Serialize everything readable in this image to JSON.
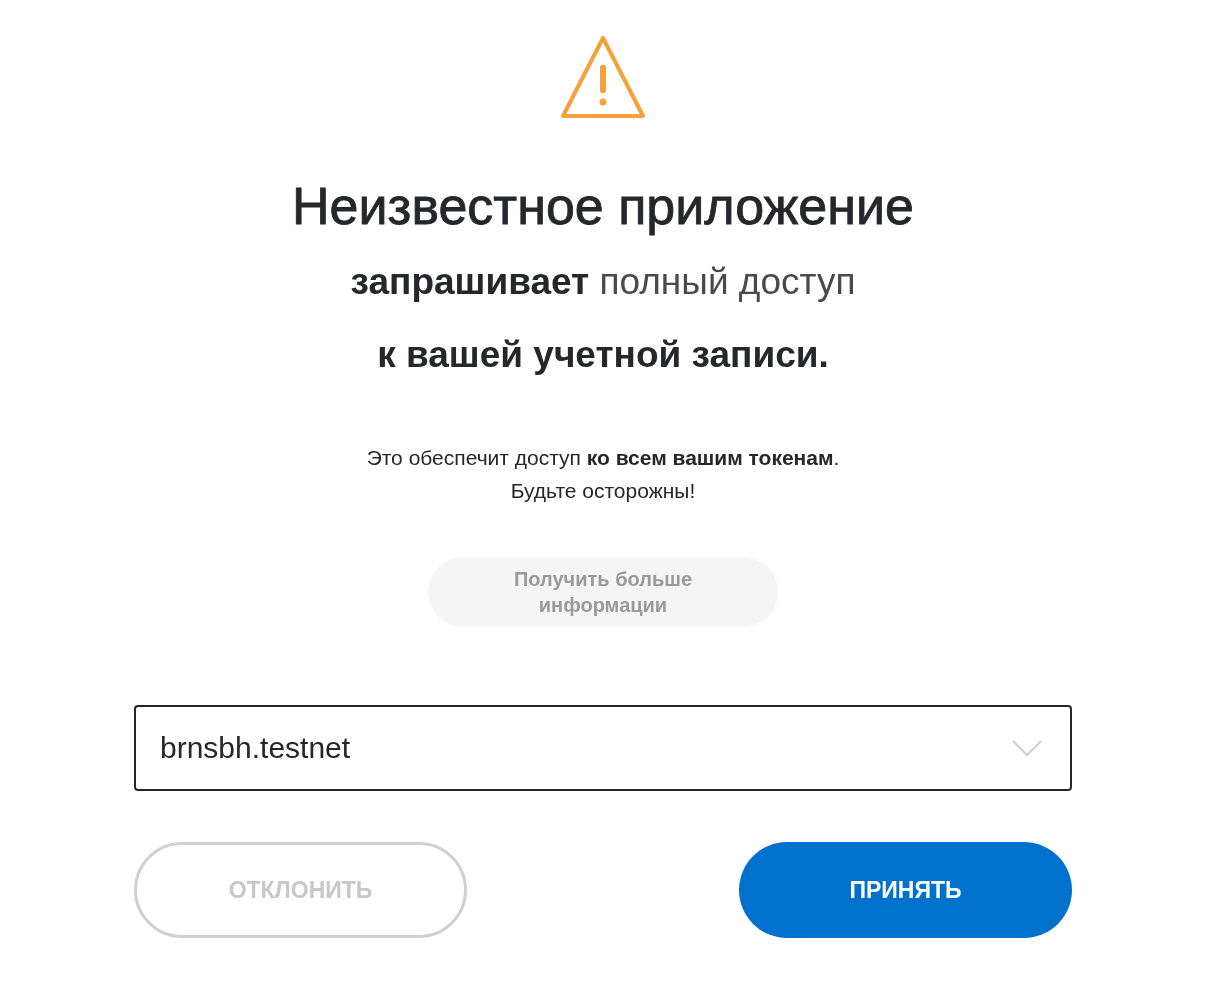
{
  "title": "Неизвестное приложение",
  "subtitle_lines": [
    {
      "text": "**запрашивает** полный доступ",
      "bold": false
    },
    {
      "text": "к вашей учетной записи.",
      "bold": true
    }
  ],
  "notice_lines": [
    "Это обеспечит доступ **ко всем вашим токенам**.",
    "Будьте осторожны!"
  ],
  "more_info_button": {
    "label": "Получить больше информации"
  },
  "account_select": {
    "value": "brnsbh.testnet"
  },
  "buttons": [
    {
      "label": "ОТКЛОНИТЬ",
      "kind": "secondary",
      "disabled": true
    },
    {
      "label": "ПРИНЯТЬ",
      "kind": "primary",
      "disabled": false
    }
  ]
}
